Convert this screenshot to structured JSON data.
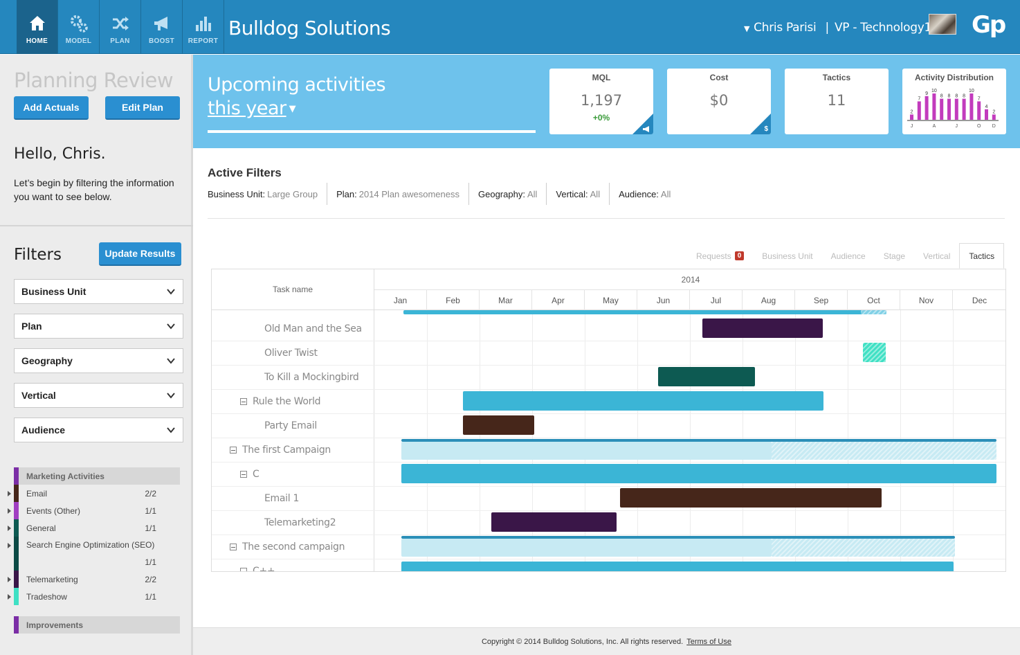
{
  "nav": {
    "items": [
      {
        "label": "HOME",
        "icon": "home-icon"
      },
      {
        "label": "MODEL",
        "icon": "gears-icon"
      },
      {
        "label": "PLAN",
        "icon": "shuffle-icon"
      },
      {
        "label": "BOOST",
        "icon": "megaphone-icon"
      },
      {
        "label": "REPORT",
        "icon": "bar-chart-icon"
      }
    ]
  },
  "header": {
    "company": "Bulldog Solutions",
    "user": "Chris Parisi",
    "separator": "|",
    "role": "VP - Technology1",
    "logo": "Gp"
  },
  "sidebar": {
    "title": "Planning Review",
    "add_actuals": "Add Actuals",
    "edit_plan": "Edit Plan",
    "hello": "Hello, Chris.",
    "intro": "Let’s begin by filtering the information you want to see below.",
    "filters_title": "Filters",
    "update_results": "Update Results",
    "dropdowns": [
      "Business Unit",
      "Plan",
      "Geography",
      "Vertical",
      "Audience"
    ],
    "activities_header": "Marketing Activities",
    "activities": [
      {
        "label": "Email",
        "count": "2/2",
        "color": "#46261a"
      },
      {
        "label": "Events (Other)",
        "count": "1/1",
        "color": "#a13fc2"
      },
      {
        "label": "General",
        "count": "1/1",
        "color": "#0d5a52"
      },
      {
        "label": "Search Engine Optimization (SEO)",
        "count": "1/1",
        "color": "#0b4a45"
      },
      {
        "label": "Telemarketing",
        "count": "2/2",
        "color": "#3a1648"
      },
      {
        "label": "Tradeshow",
        "count": "1/1",
        "color": "#3fe0c4"
      }
    ],
    "improvements_header": "Improvements"
  },
  "banner": {
    "upcoming": "Upcoming activities",
    "period": "this year",
    "kpis": {
      "mql": {
        "label": "MQL",
        "value": "1,197",
        "delta": "+0%"
      },
      "cost": {
        "label": "Cost",
        "value": "$0",
        "corner": "$"
      },
      "tactics": {
        "label": "Tactics",
        "value": "11"
      },
      "distribution": {
        "label": "Activity Distribution",
        "values": [
          2,
          7,
          9,
          10,
          8,
          8,
          8,
          8,
          10,
          7,
          4,
          2
        ],
        "value_labels": [
          "2",
          "7",
          "9",
          "10",
          "8",
          "8",
          "8",
          "8",
          "10",
          "7",
          "4",
          "2"
        ],
        "axis_labels": [
          "J",
          "A",
          "J",
          "O",
          "D"
        ],
        "color": "#c23bbd"
      }
    }
  },
  "filters": {
    "title": "Active Filters",
    "items": [
      {
        "key": "Business Unit:",
        "value": "Large Group"
      },
      {
        "key": "Plan:",
        "value": "2014 Plan awesomeness"
      },
      {
        "key": "Geography:",
        "value": "All"
      },
      {
        "key": "Vertical:",
        "value": "All"
      },
      {
        "key": "Audience:",
        "value": "All"
      }
    ]
  },
  "tabs": {
    "items": [
      "Requests",
      "Business Unit",
      "Audience",
      "Stage",
      "Vertical",
      "Tactics"
    ],
    "requests_badge": "0",
    "active": "Tactics"
  },
  "gantt": {
    "task_header": "Task name",
    "year": "2014",
    "months": [
      "Jan",
      "Feb",
      "Mar",
      "Apr",
      "May",
      "Jun",
      "Jul",
      "Aug",
      "Sep",
      "Oct",
      "Nov",
      "Dec"
    ],
    "rows": [
      {
        "label": "Old Man and the Sea",
        "level": 3
      },
      {
        "label": "Oliver Twist",
        "level": 3
      },
      {
        "label": "To Kill a Mockingbird",
        "level": 3
      },
      {
        "label": "Rule the World",
        "level": 2
      },
      {
        "label": "Party Email",
        "level": 3
      },
      {
        "label": "The first Campaign",
        "level": 1
      },
      {
        "label": "C",
        "level": 2
      },
      {
        "label": "Email 1",
        "level": 3
      },
      {
        "label": "Telemarketing2",
        "level": 3
      },
      {
        "label": "The second campaign",
        "level": 1
      },
      {
        "label": "C++",
        "level": 2
      }
    ]
  },
  "footer": {
    "copyright": "Copyright © 2014 Bulldog Solutions, Inc. All rights reserved.",
    "terms": "Terms of Use"
  }
}
